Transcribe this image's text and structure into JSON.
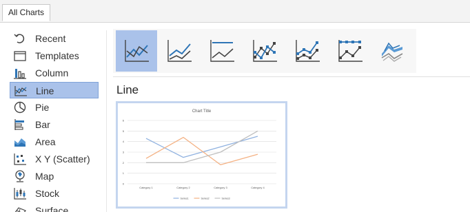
{
  "tabs": [
    {
      "label": "All Charts"
    }
  ],
  "sidebar": {
    "items": [
      {
        "label": "Recent",
        "icon": "recent-icon"
      },
      {
        "label": "Templates",
        "icon": "templates-icon"
      },
      {
        "label": "Column",
        "icon": "column-chart-icon"
      },
      {
        "label": "Line",
        "icon": "line-chart-icon",
        "selected": true
      },
      {
        "label": "Pie",
        "icon": "pie-chart-icon"
      },
      {
        "label": "Bar",
        "icon": "bar-chart-icon"
      },
      {
        "label": "Area",
        "icon": "area-chart-icon"
      },
      {
        "label": "X Y (Scatter)",
        "icon": "scatter-chart-icon"
      },
      {
        "label": "Map",
        "icon": "map-chart-icon"
      },
      {
        "label": "Stock",
        "icon": "stock-chart-icon"
      },
      {
        "label": "Surface",
        "icon": "surface-chart-icon"
      }
    ]
  },
  "subtypes": [
    {
      "icon": "line-icon",
      "selected": true
    },
    {
      "icon": "stacked-line-icon"
    },
    {
      "icon": "100-stacked-line-icon"
    },
    {
      "icon": "line-with-markers-icon"
    },
    {
      "icon": "stacked-line-with-markers-icon"
    },
    {
      "icon": "100-stacked-line-with-markers-icon"
    },
    {
      "icon": "3d-line-icon"
    }
  ],
  "main": {
    "chart_type_title": "Line"
  },
  "colors": {
    "series1": "#8fb1e0",
    "series2": "#f4b183",
    "series3": "#bfbfbf",
    "selection": "#aac2ea",
    "accent": "#2e75b6"
  },
  "chart_data": {
    "type": "line",
    "title": "Chart Title",
    "categories": [
      "Category 1",
      "Category 2",
      "Category 3",
      "Category 4"
    ],
    "series": [
      {
        "name": "Series1",
        "values": [
          4.3,
          2.5,
          3.5,
          4.5
        ]
      },
      {
        "name": "Series2",
        "values": [
          2.4,
          4.4,
          1.8,
          2.8
        ]
      },
      {
        "name": "Series3",
        "values": [
          2,
          2,
          3,
          5
        ]
      }
    ],
    "ylim": [
      0,
      6
    ],
    "yticks": [
      "0",
      "1",
      "2",
      "3",
      "4",
      "5",
      "6"
    ],
    "grid": true,
    "legend": "bottom",
    "xlabel": "",
    "ylabel": ""
  }
}
